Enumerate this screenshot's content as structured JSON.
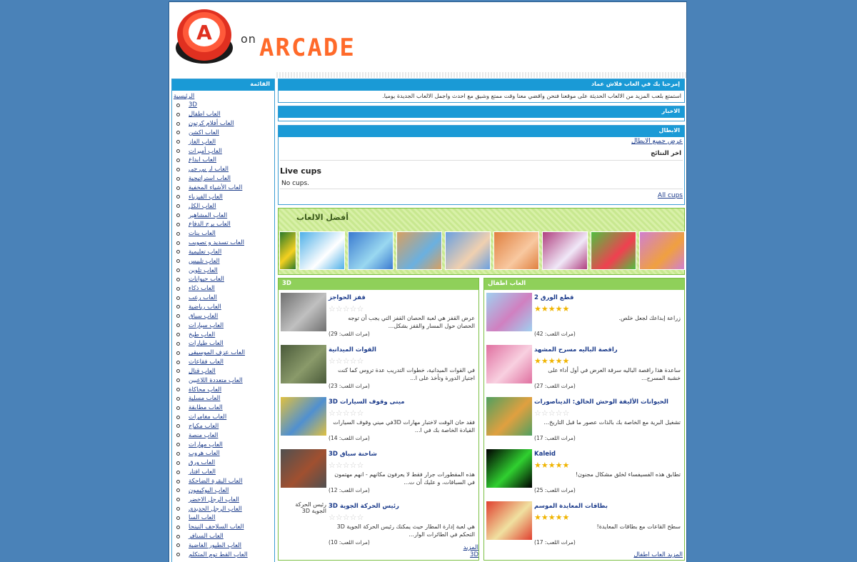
{
  "header": {
    "logo_letter": "A",
    "logo_on": "on",
    "logo_arcade": "ARCADE"
  },
  "sidebar": {
    "title": "القائمة",
    "home": "الرئيسية",
    "items": [
      "3D",
      "العاب اطفال",
      "العاب أفلام كرتون",
      "العاب اكشن",
      "العاب الغاز",
      "العاب أميرات",
      "العاب ابداع",
      "العاب ار بي جي",
      "العاب استراتيجية",
      "العاب الأشياء المخفية",
      "العاب الفيزياء",
      "العاب الكل",
      "العاب المشاهير",
      "العاب برج الدفاع",
      "العاب بنات",
      "العاب تسديد و تصويب",
      "العاب تعليمية",
      "العاب تلبيس",
      "العاب تلوين",
      "العاب حيوانات",
      "العاب ذكاء",
      "العاب رعب",
      "العاب رياضية",
      "العاب سباق",
      "العاب سيارات",
      "العاب طبخ",
      "العاب طيارات",
      "العاب عزف الموسيقى",
      "العاب فقاعات",
      "العاب قتال",
      "العاب متعددة اللاعبين",
      "العاب محاكاة",
      "العاب مسلية",
      "العاب مطابقة",
      "العاب مغامرات",
      "العاب مكياج",
      "العاب منصة",
      "العاب مهارات",
      "العاب هروب",
      "العاب ورق",
      "العاب افتار",
      "العاب البقرة الضاحكة",
      "العاب البوكيمون",
      "العاب الرجل الاخضر",
      "العاب الرجل الحديدي",
      "العاب السا",
      "العاب السلاحف النينجا",
      "العاب السنافر",
      "العاب الطيور الغاضبة",
      "العاب القط توم المتكلم"
    ]
  },
  "welcome": {
    "title": "إمرحبا بك في العاب فلاش عماد",
    "text": "استمتع بلعب المزيد من الالعاب الحديثة على موقعنا فنحن واقضي معنا وقت ممتع وشيق مع احدث واجمل الالعاب الجديدة يوميا."
  },
  "news": {
    "title": "الاخبار"
  },
  "heroes": {
    "title": "الابطال",
    "all_link": "عرض جميع الابطال",
    "results_title": "اخر النتائج",
    "live_cups": "Live cups",
    "no_cups": "No cups.",
    "all_cups": "All cups"
  },
  "best": {
    "title": "أفضل الالعاب",
    "thumbs": [
      {
        "name": "frog-game",
        "c1": "#2a7a2a",
        "c2": "#f4d020",
        "w": 24
      },
      {
        "name": "dolphin-game",
        "c1": "#4fb0e8",
        "c2": "#ffffff",
        "w": 64
      },
      {
        "name": "pool-game",
        "c1": "#3a7ad0",
        "c2": "#9ad8f0",
        "w": 64
      },
      {
        "name": "comic-game",
        "c1": "#d8a060",
        "c2": "#6ab0e0",
        "w": 64
      },
      {
        "name": "kiss-game",
        "c1": "#6aa0e0",
        "c2": "#f0d0b0",
        "w": 64
      },
      {
        "name": "girls-game",
        "c1": "#e08040",
        "c2": "#f8c8a0",
        "w": 64
      },
      {
        "name": "angel-game",
        "c1": "#b04080",
        "c2": "#f0e8f8",
        "w": 64
      },
      {
        "name": "match-game",
        "c1": "#50c040",
        "c2": "#f04050",
        "w": 64
      },
      {
        "name": "princess-game",
        "c1": "#d080d0",
        "c2": "#f0a040",
        "w": 64
      }
    ]
  },
  "panel_3d": {
    "title": "3D",
    "more": "المزيد 3D",
    "games": [
      {
        "title": "قفز الحواجز",
        "desc": "عرض القفز هي لعبة الحصان القفز التي يجب أن توجه الحصان حول المسار والقفز بشكل...",
        "plays": "(مرات اللعب: 29)",
        "stars": "☆☆☆☆☆",
        "c1": "#707070",
        "c2": "#c0c0c0"
      },
      {
        "title": "القوات الميدانية",
        "desc": "في القوات الميدانية، خطوات التدريب عدة تروس كما كنت اجتياز الدورة وتأخذ على ا...",
        "plays": "(مرات اللعب: 23)",
        "stars": "☆☆☆☆☆",
        "c1": "#4a5a3a",
        "c2": "#8a9a6a"
      },
      {
        "title": "مينى وقوف السيارات 3D",
        "desc": "فقد حان الوقت لاختبار مهارات 3Dفي ميني وقوف السيارات القيادة الخاصة بك في ا...",
        "plays": "(مرات اللعب: 14)",
        "stars": "☆☆☆☆☆",
        "c1": "#e0c040",
        "c2": "#5090d0"
      },
      {
        "title": "شاحنة سباق 3D",
        "desc": "هذه المقطورات جرار فقط لا يعرفون مكانهم - انهم مهتمون في السباقات، و عليك أن ت...",
        "plays": "(مرات اللعب: 12)",
        "stars": "☆☆☆☆☆",
        "c1": "#505050",
        "c2": "#a05030"
      },
      {
        "title": "رئيس الحركة الجوية 3D",
        "desc": "هي لعبة إدارة المطار حيث يمكنك رئيس الحركة الجوية 3D التحكم في الطائرات الوار...",
        "plays": "(مرات اللعب: 10)",
        "stars": "☆☆☆☆☆",
        "alt": "رئيس الحركة الجوية 3D",
        "c1": "#ffffff",
        "c2": "#ffffff"
      }
    ]
  },
  "panel_kids": {
    "title": "العاب اطفال",
    "more": "المزيد العاب اطفال",
    "games": [
      {
        "title": "قطع الورق 2",
        "desc": "زراعة إبداعك لجعل خلص.",
        "plays": "(مرات اللعب: 42)",
        "stars": "★★★★★",
        "c1": "#a0d0f0",
        "c2": "#d080c0"
      },
      {
        "title": "راقصة الباليه مسرح المشهد",
        "desc": "ساعدة هذا راقصة الباليه سرقة العرض في أول أداء على خشبة المسرح...",
        "plays": "(مرات اللعب: 27)",
        "stars": "★★★★★",
        "c1": "#e070a0",
        "c2": "#f8d0e0"
      },
      {
        "title": "الحيوانات الأليفة الوحش الخالق: الديناصورات",
        "desc": "تشغيل البرية مع الخاصة بك بالذات عصور ما قبل التاريخ...",
        "plays": "(مرات اللعب: 17)",
        "stars": "☆☆☆☆☆",
        "c1": "#50a060",
        "c2": "#e0a040"
      },
      {
        "title": "Kaleid",
        "desc": "تطابق هذه الفسيفساء لخلق مشكال مجنون!",
        "plays": "(مرات اللعب: 25)",
        "stars": "★★★★★",
        "c1": "#000000",
        "c2": "#30d030"
      },
      {
        "title": "بطاقات المعايدة الموسم",
        "desc": "سطح القاعات مع بطاقات المعايدة!",
        "plays": "(مرات اللعب: 17)",
        "stars": "★★★★★",
        "c1": "#e04030",
        "c2": "#f0e0a0"
      }
    ]
  },
  "colors": {
    "background": "#4a82b8",
    "box_head": "#1a9ad6",
    "panel_head": "#8fd05a",
    "link": "#1a3a8a"
  }
}
